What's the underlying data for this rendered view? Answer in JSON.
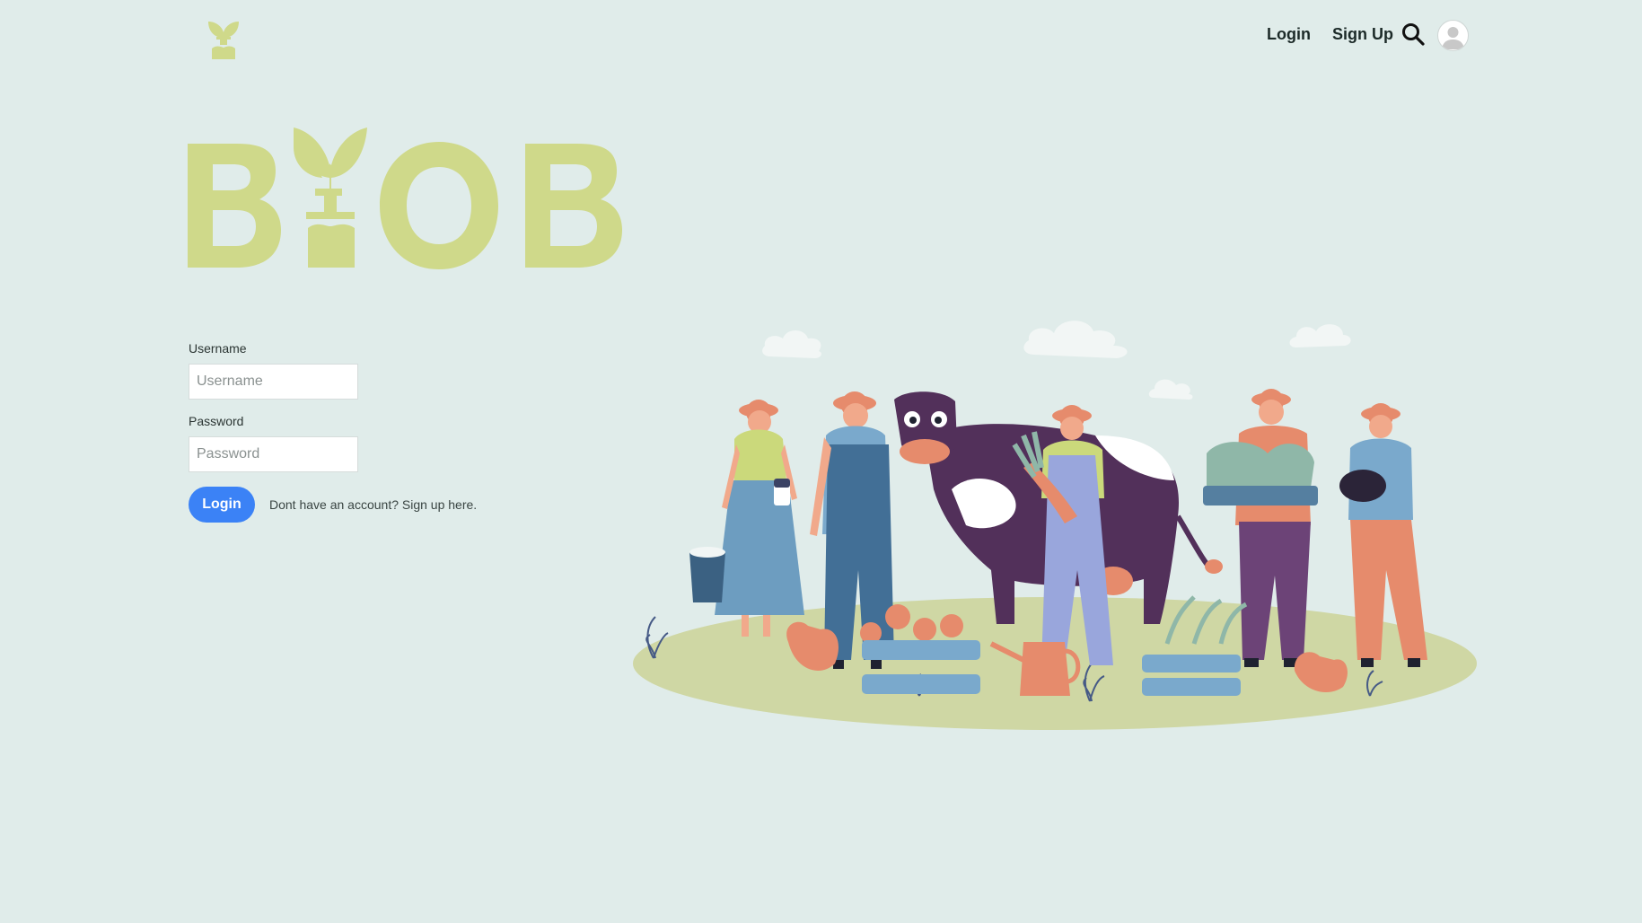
{
  "header": {
    "logo_icon": "sprout-logo-icon",
    "nav": {
      "login_label": "Login",
      "signup_label": "Sign Up"
    },
    "search_icon": "search-icon",
    "avatar_icon": "user-avatar-icon"
  },
  "brand": {
    "wordmark": "BIOB"
  },
  "form": {
    "username_label": "Username",
    "username_placeholder": "Username",
    "username_value": "",
    "password_label": "Password",
    "password_placeholder": "Password",
    "password_value": "",
    "login_button_label": "Login",
    "signup_prompt": "Dont have an account? Sign up here."
  },
  "illustration": {
    "name": "farmers-with-cow-illustration"
  },
  "colors": {
    "background": "#e0ecea",
    "brand_green": "#cfd98a",
    "primary_button": "#3b82f6",
    "nav_text": "#1c2a28"
  }
}
